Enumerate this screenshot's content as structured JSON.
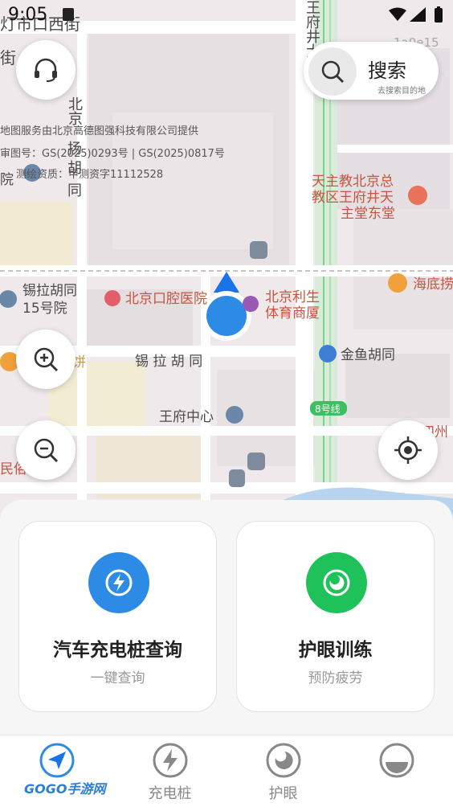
{
  "status_bar": {
    "time": "9:05"
  },
  "map": {
    "tag": "1a0e15",
    "credits": {
      "line1": "地图服务由北京高德图强科技有限公司提供",
      "line2": "审图号：GS(2025)0293号 | GS(2025)0817号",
      "line3": "测绘资质：甲测资字11112528"
    },
    "labels": {
      "street_top": "灯市口西街",
      "street_top2": "街",
      "lane_v1": "北京",
      "lane_v2": "扬",
      "lane_v3": "胡",
      "lane_v4": "同",
      "wangfu_top": "王府井大街",
      "church": "天主教北京总教区王府井天主堂东堂",
      "church_l1": "天主教北京总",
      "church_l2": "教区王府井天",
      "church_l3": "主堂东堂",
      "xila_15_l1": "锡拉胡同",
      "xila_15_l2": "15号院",
      "dental": "北京口腔医院",
      "lisheng_l1": "北京利生",
      "lisheng_l2": "体育商厦",
      "haidi": "海底捞",
      "xila": "锡 拉 胡 同",
      "jinyu": "金鱼胡同",
      "line8": "8号线",
      "wangfu_center": "王府中心",
      "left_bottom": "民俗酒店",
      "left_mid": "饼",
      "right_bottom": "四州",
      "left_top1": "院"
    }
  },
  "search": {
    "label": "搜索",
    "hint": "去搜索目的地"
  },
  "cards": [
    {
      "title": "汽车充电桩查询",
      "subtitle": "一键查询",
      "color": "#2d8be6"
    },
    {
      "title": "护眼训练",
      "subtitle": "预防疲劳",
      "color": "#1fc25a"
    }
  ],
  "tabs": [
    {
      "label": "",
      "icon": "navigation-icon"
    },
    {
      "label": "充电桩",
      "icon": "charging-icon"
    },
    {
      "label": "护眼",
      "icon": "eye-care-icon"
    },
    {
      "label": "",
      "icon": "profile-icon"
    }
  ],
  "watermark": "GOGO手游网"
}
